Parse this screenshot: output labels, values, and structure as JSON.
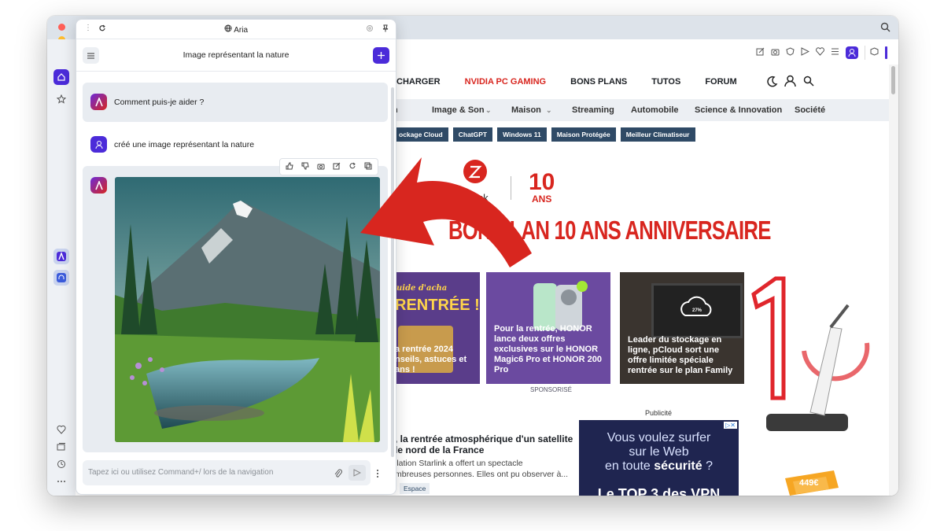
{
  "aria": {
    "top_title": "Aria",
    "chat_title": "Image représentant la nature",
    "greeting": "Comment puis-je aider ?",
    "user_message": "créé une image représentant la nature",
    "input_placeholder": "Tapez ici ou utilisez Command+/ lors de la navigation"
  },
  "site": {
    "nav_primary": [
      "CHARGER",
      "NVIDIA PC GAMING",
      "BONS PLANS",
      "TUTOS",
      "FORUM"
    ],
    "nav_primary_accent": "#d8261f",
    "nav_secondary": [
      "n",
      "Image & Son",
      "Maison",
      "Streaming",
      "Automobile",
      "Science & Innovation",
      "Société"
    ],
    "tags": [
      "ockage Cloud",
      "ChatGPT",
      "Windows 11",
      "Maison Protégée",
      "Meilleur Climatiseur"
    ],
    "promo": {
      "brand": "roborock",
      "anniv_number": "10",
      "anniv_word": "ANS",
      "title": "BON PLAN 10 ANS ANNIVERSAIRE",
      "color": "#d8261f"
    },
    "cards": [
      {
        "overlay": "uide d'acha",
        "headline": "RENTRÉE !",
        "text": "a rentrée 2024 nseils, astuces et ans !"
      },
      {
        "text": "Pour la rentrée, HONOR lance deux offres exclusives sur le HONOR Magic6 Pro et HONOR 200 Pro"
      },
      {
        "text": "Leader du stockage en ligne, pCloud sort une offre limitée spéciale rentrée sur le plan Family",
        "cloud_label": "27%"
      }
    ],
    "sponsored": "SPONSORISÉ",
    "ad_label": "Publicité",
    "ad_text_1": "Vous voulez surfer",
    "ad_text_2": "sur le Web",
    "ad_text_3": "en toute",
    "ad_text_3b": "sécurité",
    "ad_text_3c": "?",
    "ad_banner": "Le TOP 3 des VPN",
    "article": {
      "title_1": ", la rentrée atmosphérique d'un satellite",
      "title_2": "le nord de la France",
      "excerpt_1": "llation Starlink a offert un spectacle",
      "excerpt_2": "mbreuses personnes. Elles ont pu observer à...",
      "tag": "Espace"
    },
    "price_ticket": "449€"
  },
  "colors": {
    "aria_accent": "#4b2bd9",
    "arrow_red": "#d8261f"
  }
}
